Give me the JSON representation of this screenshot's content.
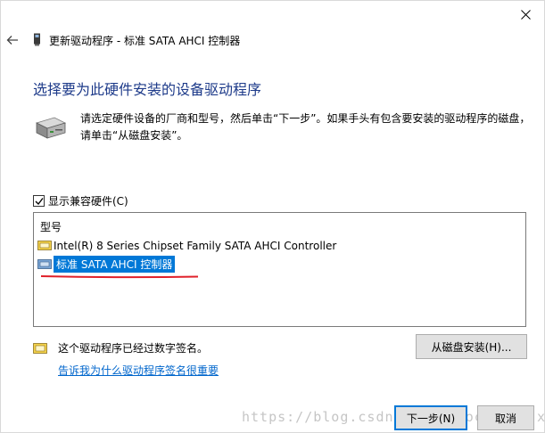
{
  "window": {
    "title": "更新驱动程序 - 标准 SATA AHCI 控制器"
  },
  "heading": "选择要为此硬件安装的设备驱动程序",
  "description": "请选定硬件设备的厂商和型号，然后单击“下一步”。如果手头有包含要安装的驱动程序的磁盘，请单击“从磁盘安装”。",
  "compat_checkbox": {
    "label": "显示兼容硬件(C)",
    "checked": true
  },
  "model_list": {
    "header": "型号",
    "items": [
      {
        "label": "Intel(R) 8 Series Chipset Family SATA AHCI Controller",
        "selected": false
      },
      {
        "label": "标准 SATA AHCI 控制器",
        "selected": true
      }
    ]
  },
  "signed_text": "这个驱动程序已经过数字签名。",
  "signing_link": "告诉我为什么驱动程序签名很重要",
  "buttons": {
    "have_disk": "从磁盘安装(H)...",
    "next": "下一步(N)",
    "cancel": "取消"
  },
  "watermark": "https://blog.csdn.net/xiaochuan_jx",
  "icons": {
    "close": "close-icon",
    "back": "back-arrow-icon",
    "title": "device-icon",
    "hardware": "hardware-drive-icon",
    "list_item": "device-driver-icon",
    "signed": "signed-driver-icon"
  },
  "colors": {
    "heading": "#1e3b8a",
    "selection": "#0078d7",
    "link": "#0066cc",
    "annotation_underline": "#e0202a"
  }
}
